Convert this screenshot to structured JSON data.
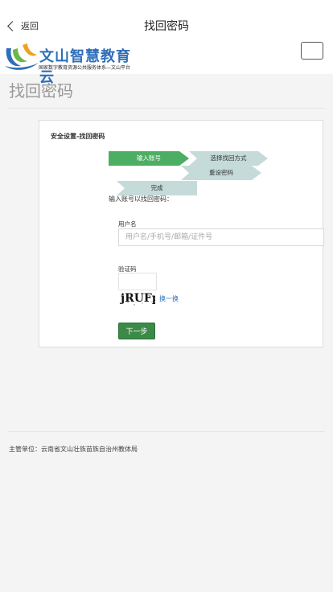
{
  "nav": {
    "back_label": "返回",
    "title": "找回密码"
  },
  "logo": {
    "name": "文山智慧教育云",
    "subtitle": "国家数字教育资源公共服务体系—文山平台"
  },
  "heading": "找回密码",
  "card": {
    "title": "安全设置-找回密码",
    "steps": [
      "输入账号",
      "选择找回方式",
      "重设密码",
      "完成"
    ],
    "hint": "输入账号以找回密码：",
    "username_label": "用户名",
    "username_placeholder": "用户名/手机号/邮箱/证件号",
    "captcha_label": "验证码",
    "captcha_text": "jRUFp",
    "refresh_label": "换一换",
    "next_label": "下一步"
  },
  "footer": {
    "text": "主管单位：云南省文山壮族苗族自治州教体局"
  },
  "colors": {
    "step_active": "#4cae62",
    "step_inactive": "#c4dbd9",
    "next_button": "#3c8a47",
    "link": "#2a6fc0",
    "logo_text": "#2f6fb8"
  }
}
